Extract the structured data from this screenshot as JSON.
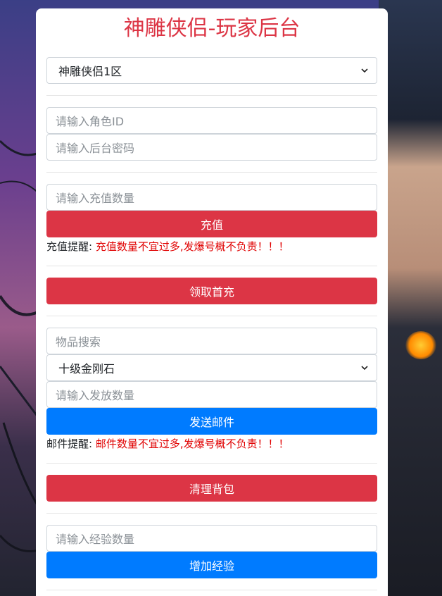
{
  "title": "神雕侠侣-玩家后台",
  "server_select": {
    "value": "神雕侠侣1区"
  },
  "role_id": {
    "placeholder": "请输入角色ID"
  },
  "password": {
    "placeholder": "请输入后台密码"
  },
  "recharge": {
    "placeholder": "请输入充值数量",
    "button": "充值",
    "note_label": "充值提醒: ",
    "note_text": "充值数量不宜过多,发爆号概不负责！！！"
  },
  "first_recharge": {
    "button": "领取首充"
  },
  "mail": {
    "search_placeholder": "物品搜索",
    "item_select_value": "十级金刚石",
    "quantity_placeholder": "请输入发放数量",
    "button": "发送邮件",
    "note_label": "邮件提醒: ",
    "note_text": "邮件数量不宜过多,发爆号概不负责！！！"
  },
  "clear_bag": {
    "button": "清理背包"
  },
  "exp": {
    "placeholder": "请输入经验数量",
    "button": "增加经验"
  },
  "colors": {
    "accent_red": "#dc3545",
    "accent_blue": "#007bff",
    "warning_text": "#e00000"
  }
}
